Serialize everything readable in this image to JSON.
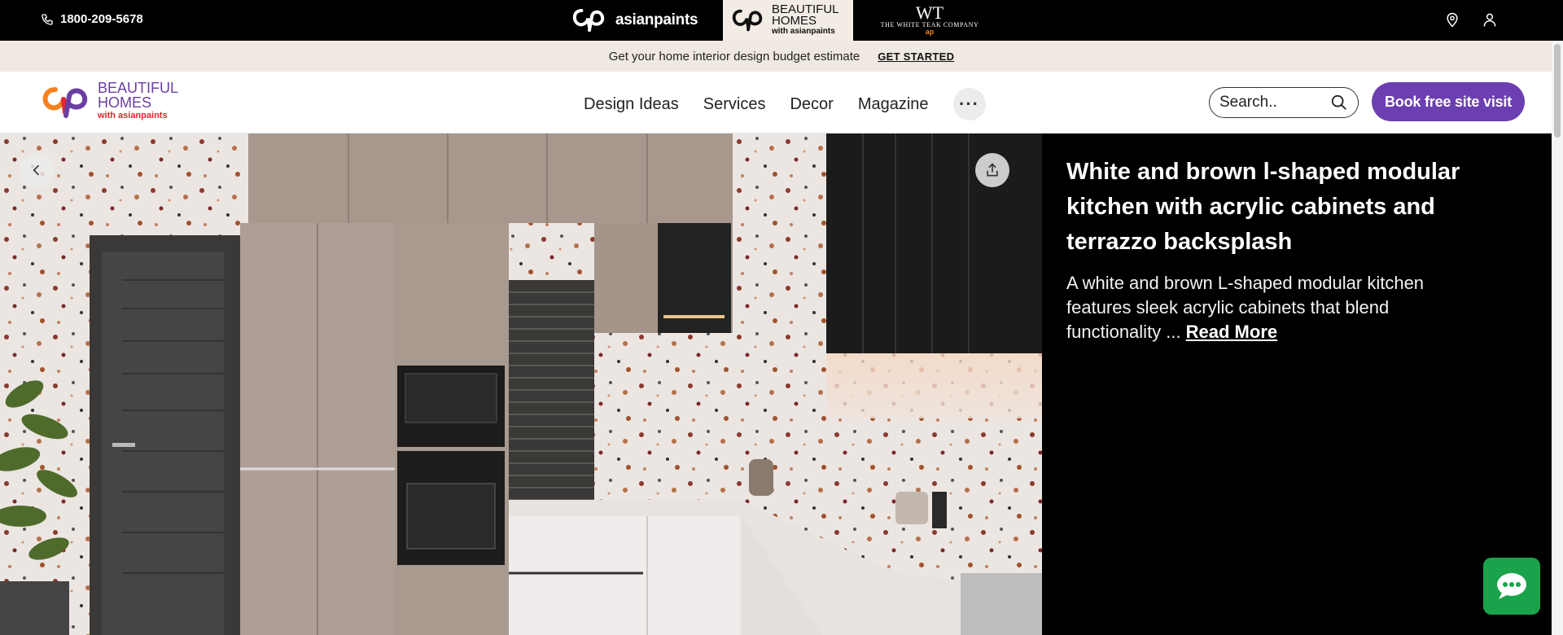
{
  "topbar": {
    "phone": "1800-209-5678",
    "brand_asianpaints": "asianpaints",
    "brand_beautiful_homes": {
      "line1": "BEAUTIFUL",
      "line2": "HOMES",
      "sub": "with asianpaints"
    },
    "brand_whiteteak": {
      "mark": "WT",
      "name": "THE WHITE TEAK COMPANY",
      "sub": "ap"
    },
    "icons": [
      "location-pin-icon",
      "user-icon"
    ]
  },
  "promo": {
    "text": "Get your home interior design budget estimate",
    "cta": "GET STARTED"
  },
  "nav": {
    "logo": {
      "line1": "BEAUTIFUL",
      "line2": "HOMES",
      "sub": "with asianpaints"
    },
    "items": [
      {
        "label": "Design Ideas"
      },
      {
        "label": "Services"
      },
      {
        "label": "Decor"
      },
      {
        "label": "Magazine"
      }
    ],
    "more_label": "···",
    "search_placeholder": "Search..",
    "book_button": "Book free site visit"
  },
  "hero": {
    "title": "White and brown l-shaped modular kitchen with acrylic cabinets and terrazzo backsplash",
    "description": "A white and brown L-shaped modular kitchen features sleek acrylic cabinets that blend functionality ...",
    "read_more": "Read More"
  },
  "colors": {
    "brand_purple": "#6c3fb0",
    "chat_green": "#1aa34a",
    "promo_bg": "#efe9e1"
  }
}
